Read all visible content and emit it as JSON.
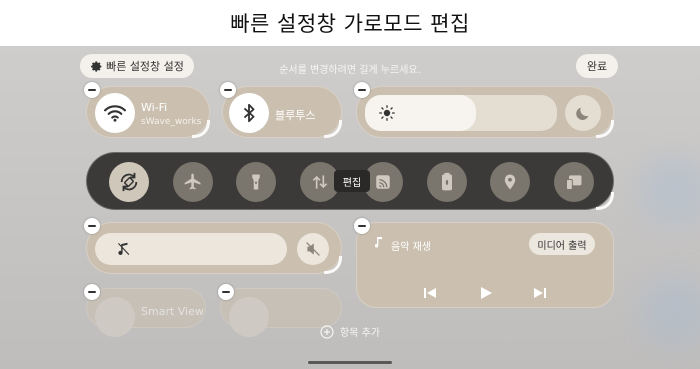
{
  "banner": {
    "title": "빠른 설정창 가로모드 편집"
  },
  "top_bar": {
    "settings_label": "빠른 설정창 설정",
    "hint": "순서를 변경하려면 길게 누르세요.",
    "done_label": "완료"
  },
  "tiles": {
    "wifi": {
      "title": "Wi-Fi",
      "subtitle": "sWave_works"
    },
    "bluetooth": {
      "title": "블루투스"
    },
    "brightness": {
      "level": 0.58
    }
  },
  "quick_buttons": [
    {
      "icon": "auto-rotate-icon",
      "active": true
    },
    {
      "icon": "airplane-icon",
      "active": false
    },
    {
      "icon": "flashlight-icon",
      "active": false
    },
    {
      "icon": "data-transfer-icon",
      "active": false
    },
    {
      "icon": "cast-icon",
      "active": false
    },
    {
      "icon": "battery-saver-icon",
      "active": false
    },
    {
      "icon": "location-icon",
      "active": false
    },
    {
      "icon": "device-icon",
      "active": false
    }
  ],
  "tooltip": {
    "label": "편집"
  },
  "media": {
    "title": "음악 재생",
    "output_label": "미디어 출력"
  },
  "bottom_tiles": {
    "partial_label": "Smart View"
  },
  "add_item_label": "항목 추가",
  "colors": {
    "tile": "#cbc0b0",
    "tile_dark": "#3c3a38",
    "background": "#c6c4c3"
  }
}
